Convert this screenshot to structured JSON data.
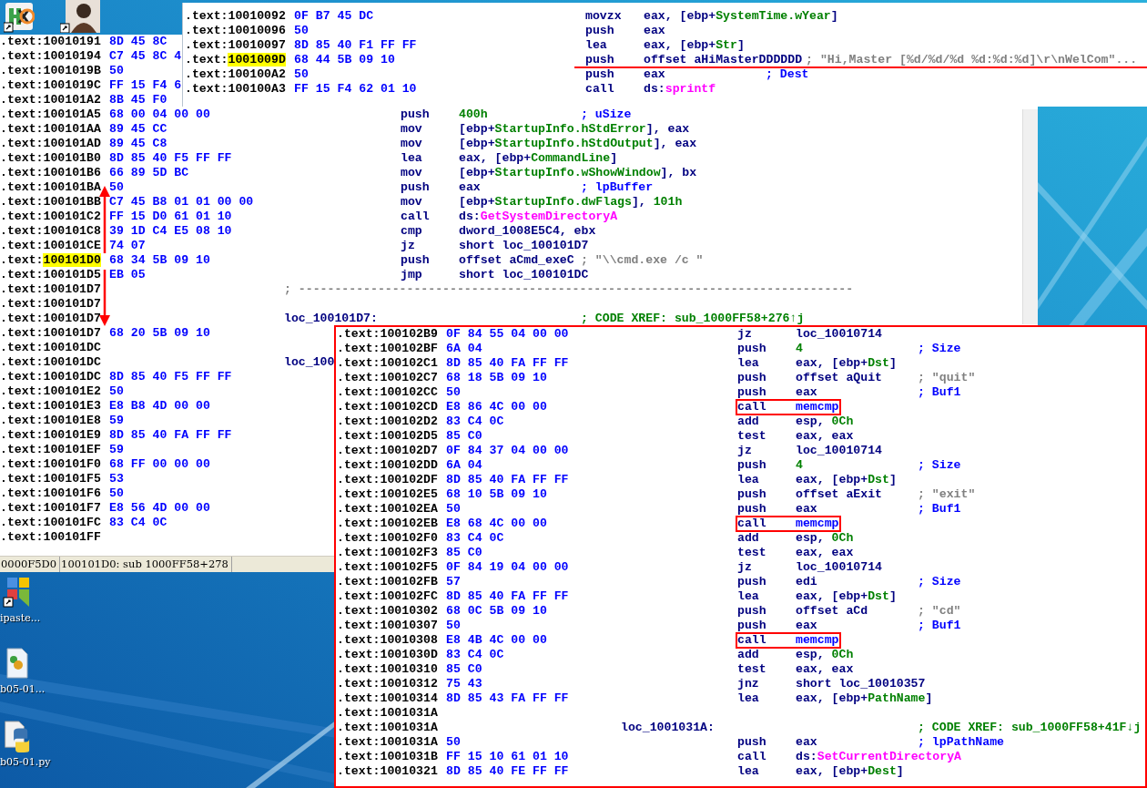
{
  "desktop_icons": [
    {
      "kind": "hex"
    },
    {
      "kind": "portrait"
    },
    {
      "kind": "tiles",
      "label": "ipaste..."
    },
    {
      "kind": "script",
      "label": "b05-01..."
    },
    {
      "kind": "python",
      "label": "b05-01.py"
    }
  ],
  "windows": [
    {
      "kind": "main",
      "status_bar": [
        "0000F5D0",
        "100101D0: sub 1000FF58+278"
      ],
      "rows": [
        {
          "segment": ".text:",
          "address": "10010191",
          "bytes": "8D 45 8C",
          "highlighted": false
        },
        {
          "segment": ".text:",
          "address": "10010194",
          "bytes": "C7 45 8C 4",
          "highlighted": false
        },
        {
          "segment": ".text:",
          "address": "1001019B",
          "bytes": "50",
          "highlighted": false
        },
        {
          "segment": ".text:",
          "address": "1001019C",
          "bytes": "FF 15 F4 6",
          "highlighted": false
        },
        {
          "segment": ".text:",
          "address": "100101A2",
          "bytes": "8B 45 F0",
          "highlighted": false
        },
        {
          "segment": ".text:",
          "address": "100101A5",
          "bytes": "68 00 04 00 00",
          "highlighted": false,
          "mnemonic": "push",
          "operand": [
            {
              "text": "400h",
              "kind": "name"
            }
          ],
          "comment": {
            "text": "; uSize",
            "kind": "auto"
          }
        },
        {
          "segment": ".text:",
          "address": "100101AA",
          "bytes": "89 45 CC",
          "highlighted": false,
          "mnemonic": "mov",
          "operand": [
            {
              "text": "[ebp+",
              "kind": "plain"
            },
            {
              "text": "StartupInfo.hStdError",
              "kind": "name"
            },
            {
              "text": "], eax",
              "kind": "plain"
            }
          ]
        },
        {
          "segment": ".text:",
          "address": "100101AD",
          "bytes": "89 45 C8",
          "highlighted": false,
          "mnemonic": "mov",
          "operand": [
            {
              "text": "[ebp+",
              "kind": "plain"
            },
            {
              "text": "StartupInfo.hStdOutput",
              "kind": "name"
            },
            {
              "text": "], eax",
              "kind": "plain"
            }
          ]
        },
        {
          "segment": ".text:",
          "address": "100101B0",
          "bytes": "8D 85 40 F5 FF FF",
          "highlighted": false,
          "mnemonic": "lea",
          "operand": [
            {
              "text": "eax, [ebp+",
              "kind": "plain"
            },
            {
              "text": "CommandLine",
              "kind": "name"
            },
            {
              "text": "]",
              "kind": "plain"
            }
          ]
        },
        {
          "segment": ".text:",
          "address": "100101B6",
          "bytes": "66 89 5D BC",
          "highlighted": false,
          "mnemonic": "mov",
          "operand": [
            {
              "text": "[ebp+",
              "kind": "plain"
            },
            {
              "text": "StartupInfo.wShowWindow",
              "kind": "name"
            },
            {
              "text": "], bx",
              "kind": "plain"
            }
          ]
        },
        {
          "segment": ".text:",
          "address": "100101BA",
          "bytes": "50",
          "highlighted": false,
          "mnemonic": "push",
          "operand": [
            {
              "text": "eax",
              "kind": "plain"
            }
          ],
          "comment": {
            "text": "; lpBuffer",
            "kind": "auto"
          }
        },
        {
          "segment": ".text:",
          "address": "100101BB",
          "bytes": "C7 45 B8 01 01 00 00",
          "highlighted": false,
          "mnemonic": "mov",
          "operand": [
            {
              "text": "[ebp+",
              "kind": "plain"
            },
            {
              "text": "StartupInfo.dwFlags",
              "kind": "name"
            },
            {
              "text": "], ",
              "kind": "plain"
            },
            {
              "text": "101h",
              "kind": "name"
            }
          ]
        },
        {
          "segment": ".text:",
          "address": "100101C2",
          "bytes": "FF 15 D0 61 01 10",
          "highlighted": false,
          "mnemonic": "call",
          "operand": [
            {
              "text": "ds:",
              "kind": "plain"
            },
            {
              "text": "GetSystemDirectoryA",
              "kind": "api"
            }
          ]
        },
        {
          "segment": ".text:",
          "address": "100101C8",
          "bytes": "39 1D C4 E5 08 10",
          "highlighted": false,
          "mnemonic": "cmp",
          "operand": [
            {
              "text": "dword_1008E5C4, ebx",
              "kind": "plain"
            }
          ]
        },
        {
          "segment": ".text:",
          "address": "100101CE",
          "bytes": "74 07",
          "highlighted": false,
          "mnemonic": "jz",
          "operand": [
            {
              "text": "short loc_100101D7",
              "kind": "plain"
            }
          ]
        },
        {
          "segment": ".text:",
          "address": "100101D0",
          "bytes": "68 34 5B 09 10",
          "highlighted": true,
          "mnemonic": "push",
          "operand": [
            {
              "text": "offset aCmd_exeC",
              "kind": "plain"
            }
          ],
          "comment": {
            "text": "; \"\\\\cmd.exe /c \"",
            "kind": "string"
          }
        },
        {
          "segment": ".text:",
          "address": "100101D5",
          "bytes": "EB 05",
          "highlighted": false,
          "mnemonic": "jmp",
          "operand": [
            {
              "text": "short loc_100101DC",
              "kind": "plain"
            }
          ]
        },
        {
          "segment": ".text:",
          "address": "100101D7",
          "highlighted": false,
          "label": {
            "text": "; -----------------------------------------------------------------------------",
            "kind": "rule"
          }
        },
        {
          "segment": ".text:",
          "address": "100101D7",
          "highlighted": false
        },
        {
          "segment": ".text:",
          "address": "100101D7",
          "highlighted": false,
          "label": {
            "text": "loc_100101D7:",
            "kind": "loc"
          },
          "comment": {
            "text": "; CODE XREF: sub_1000FF58+276↑j",
            "kind": "xref"
          }
        },
        {
          "segment": ".text:",
          "address": "100101D7",
          "bytes": "68 20 5B 09 10",
          "highlighted": false
        },
        {
          "segment": ".text:",
          "address": "100101DC",
          "highlighted": false
        },
        {
          "segment": ".text:",
          "address": "100101DC",
          "highlighted": false,
          "label": {
            "text": "loc_100",
            "kind": "loc"
          }
        },
        {
          "segment": ".text:",
          "address": "100101DC",
          "bytes": "8D 85 40 F5 FF FF",
          "highlighted": false
        },
        {
          "segment": ".text:",
          "address": "100101E2",
          "bytes": "50",
          "highlighted": false
        },
        {
          "segment": ".text:",
          "address": "100101E3",
          "bytes": "E8 B8 4D 00 00",
          "highlighted": false
        },
        {
          "segment": ".text:",
          "address": "100101E8",
          "bytes": "59",
          "highlighted": false
        },
        {
          "segment": ".text:",
          "address": "100101E9",
          "bytes": "8D 85 40 FA FF FF",
          "highlighted": false
        },
        {
          "segment": ".text:",
          "address": "100101EF",
          "bytes": "59",
          "highlighted": false
        },
        {
          "segment": ".text:",
          "address": "100101F0",
          "bytes": "68 FF 00 00 00",
          "highlighted": false
        },
        {
          "segment": ".text:",
          "address": "100101F5",
          "bytes": "53",
          "highlighted": false
        },
        {
          "segment": ".text:",
          "address": "100101F6",
          "bytes": "50",
          "highlighted": false
        },
        {
          "segment": ".text:",
          "address": "100101F7",
          "bytes": "E8 56 4D 00 00",
          "highlighted": false
        },
        {
          "segment": ".text:",
          "address": "100101FC",
          "bytes": "83 C4 0C",
          "highlighted": false
        },
        {
          "segment": ".text:",
          "address": "100101FF",
          "highlighted": false
        }
      ]
    },
    {
      "kind": "top",
      "rows": [
        {
          "segment": ".text:",
          "address": "10010092",
          "bytes": "0F B7 45 DC",
          "highlighted": false,
          "underlined": false,
          "mnemonic": "movzx",
          "operand": [
            {
              "text": "eax, [ebp+",
              "kind": "plain"
            },
            {
              "text": "SystemTime.wYear",
              "kind": "name"
            },
            {
              "text": "]",
              "kind": "plain"
            }
          ]
        },
        {
          "segment": ".text:",
          "address": "10010096",
          "bytes": "50",
          "highlighted": false,
          "underlined": false,
          "mnemonic": "push",
          "operand": [
            {
              "text": "eax",
              "kind": "plain"
            }
          ]
        },
        {
          "segment": ".text:",
          "address": "10010097",
          "bytes": "8D 85 40 F1 FF FF",
          "highlighted": false,
          "underlined": false,
          "mnemonic": "lea",
          "operand": [
            {
              "text": "eax, [ebp+",
              "kind": "plain"
            },
            {
              "text": "Str",
              "kind": "name"
            },
            {
              "text": "]",
              "kind": "plain"
            }
          ]
        },
        {
          "segment": ".text:",
          "address": "1001009D",
          "bytes": "68 44 5B 09 10",
          "highlighted": true,
          "underlined": true,
          "mnemonic": "push",
          "operand": [
            {
              "text": "offset aHiMasterDDDDDD",
              "kind": "plain"
            }
          ],
          "comment": {
            "text": "; \"Hi,Master [%d/%d/%d %d:%d:%d]\\r\\nWelCom\"...",
            "kind": "string"
          }
        },
        {
          "segment": ".text:",
          "address": "100100A2",
          "bytes": "50",
          "highlighted": false,
          "underlined": false,
          "mnemonic": "push",
          "operand": [
            {
              "text": "eax",
              "kind": "plain"
            }
          ],
          "comment": {
            "text": "; Dest",
            "kind": "auto"
          }
        },
        {
          "segment": ".text:",
          "address": "100100A3",
          "bytes": "FF 15 F4 62 01 10",
          "highlighted": false,
          "underlined": false,
          "mnemonic": "call",
          "operand": [
            {
              "text": "ds:",
              "kind": "plain"
            },
            {
              "text": "sprintf",
              "kind": "api"
            }
          ]
        }
      ]
    },
    {
      "kind": "bottom",
      "rows": [
        {
          "segment": ".text:",
          "address": "100102B9",
          "bytes": "0F 84 55 04 00 00",
          "highlighted": false,
          "boxed": false,
          "mnemonic": "jz",
          "operand": [
            {
              "text": "loc_10010714",
              "kind": "plain"
            }
          ]
        },
        {
          "segment": ".text:",
          "address": "100102BF",
          "bytes": "6A 04",
          "highlighted": false,
          "boxed": false,
          "mnemonic": "push",
          "operand": [
            {
              "text": "4",
              "kind": "name"
            }
          ],
          "comment": {
            "text": "; Size",
            "kind": "auto"
          }
        },
        {
          "segment": ".text:",
          "address": "100102C1",
          "bytes": "8D 85 40 FA FF FF",
          "highlighted": false,
          "boxed": false,
          "mnemonic": "lea",
          "operand": [
            {
              "text": "eax, [ebp+",
              "kind": "plain"
            },
            {
              "text": "Dst",
              "kind": "name"
            },
            {
              "text": "]",
              "kind": "plain"
            }
          ]
        },
        {
          "segment": ".text:",
          "address": "100102C7",
          "bytes": "68 18 5B 09 10",
          "highlighted": false,
          "boxed": false,
          "mnemonic": "push",
          "operand": [
            {
              "text": "offset aQuit",
              "kind": "plain"
            }
          ],
          "comment": {
            "text": "; \"quit\"",
            "kind": "string"
          }
        },
        {
          "segment": ".text:",
          "address": "100102CC",
          "bytes": "50",
          "highlighted": false,
          "boxed": false,
          "mnemonic": "push",
          "operand": [
            {
              "text": "eax",
              "kind": "plain"
            }
          ],
          "comment": {
            "text": "; Buf1",
            "kind": "auto"
          }
        },
        {
          "segment": ".text:",
          "address": "100102CD",
          "bytes": "E8 86 4C 00 00",
          "highlighted": false,
          "boxed": true,
          "mnemonic": "call",
          "operand": [
            {
              "text": "memcmp",
              "kind": "import"
            }
          ]
        },
        {
          "segment": ".text:",
          "address": "100102D2",
          "bytes": "83 C4 0C",
          "highlighted": false,
          "boxed": false,
          "mnemonic": "add",
          "operand": [
            {
              "text": "esp, ",
              "kind": "plain"
            },
            {
              "text": "0Ch",
              "kind": "name"
            }
          ]
        },
        {
          "segment": ".text:",
          "address": "100102D5",
          "bytes": "85 C0",
          "highlighted": false,
          "boxed": false,
          "mnemonic": "test",
          "operand": [
            {
              "text": "eax, eax",
              "kind": "plain"
            }
          ]
        },
        {
          "segment": ".text:",
          "address": "100102D7",
          "bytes": "0F 84 37 04 00 00",
          "highlighted": false,
          "boxed": false,
          "mnemonic": "jz",
          "operand": [
            {
              "text": "loc_10010714",
              "kind": "plain"
            }
          ]
        },
        {
          "segment": ".text:",
          "address": "100102DD",
          "bytes": "6A 04",
          "highlighted": false,
          "boxed": false,
          "mnemonic": "push",
          "operand": [
            {
              "text": "4",
              "kind": "name"
            }
          ],
          "comment": {
            "text": "; Size",
            "kind": "auto"
          }
        },
        {
          "segment": ".text:",
          "address": "100102DF",
          "bytes": "8D 85 40 FA FF FF",
          "highlighted": false,
          "boxed": false,
          "mnemonic": "lea",
          "operand": [
            {
              "text": "eax, [ebp+",
              "kind": "plain"
            },
            {
              "text": "Dst",
              "kind": "name"
            },
            {
              "text": "]",
              "kind": "plain"
            }
          ]
        },
        {
          "segment": ".text:",
          "address": "100102E5",
          "bytes": "68 10 5B 09 10",
          "highlighted": false,
          "boxed": false,
          "mnemonic": "push",
          "operand": [
            {
              "text": "offset aExit",
              "kind": "plain"
            }
          ],
          "comment": {
            "text": "; \"exit\"",
            "kind": "string"
          }
        },
        {
          "segment": ".text:",
          "address": "100102EA",
          "bytes": "50",
          "highlighted": false,
          "boxed": false,
          "mnemonic": "push",
          "operand": [
            {
              "text": "eax",
              "kind": "plain"
            }
          ],
          "comment": {
            "text": "; Buf1",
            "kind": "auto"
          }
        },
        {
          "segment": ".text:",
          "address": "100102EB",
          "bytes": "E8 68 4C 00 00",
          "highlighted": false,
          "boxed": true,
          "mnemonic": "call",
          "operand": [
            {
              "text": "memcmp",
              "kind": "import"
            }
          ]
        },
        {
          "segment": ".text:",
          "address": "100102F0",
          "bytes": "83 C4 0C",
          "highlighted": false,
          "boxed": false,
          "mnemonic": "add",
          "operand": [
            {
              "text": "esp, ",
              "kind": "plain"
            },
            {
              "text": "0Ch",
              "kind": "name"
            }
          ]
        },
        {
          "segment": ".text:",
          "address": "100102F3",
          "bytes": "85 C0",
          "highlighted": false,
          "boxed": false,
          "mnemonic": "test",
          "operand": [
            {
              "text": "eax, eax",
              "kind": "plain"
            }
          ]
        },
        {
          "segment": ".text:",
          "address": "100102F5",
          "bytes": "0F 84 19 04 00 00",
          "highlighted": false,
          "boxed": false,
          "mnemonic": "jz",
          "operand": [
            {
              "text": "loc_10010714",
              "kind": "plain"
            }
          ]
        },
        {
          "segment": ".text:",
          "address": "100102FB",
          "bytes": "57",
          "highlighted": false,
          "boxed": false,
          "mnemonic": "push",
          "operand": [
            {
              "text": "edi",
              "kind": "plain"
            }
          ],
          "comment": {
            "text": "; Size",
            "kind": "auto"
          }
        },
        {
          "segment": ".text:",
          "address": "100102FC",
          "bytes": "8D 85 40 FA FF FF",
          "highlighted": false,
          "boxed": false,
          "mnemonic": "lea",
          "operand": [
            {
              "text": "eax, [ebp+",
              "kind": "plain"
            },
            {
              "text": "Dst",
              "kind": "name"
            },
            {
              "text": "]",
              "kind": "plain"
            }
          ]
        },
        {
          "segment": ".text:",
          "address": "10010302",
          "bytes": "68 0C 5B 09 10",
          "highlighted": false,
          "boxed": false,
          "mnemonic": "push",
          "operand": [
            {
              "text": "offset aCd",
              "kind": "plain"
            }
          ],
          "comment": {
            "text": "; \"cd\"",
            "kind": "string"
          }
        },
        {
          "segment": ".text:",
          "address": "10010307",
          "bytes": "50",
          "highlighted": false,
          "boxed": false,
          "mnemonic": "push",
          "operand": [
            {
              "text": "eax",
              "kind": "plain"
            }
          ],
          "comment": {
            "text": "; Buf1",
            "kind": "auto"
          }
        },
        {
          "segment": ".text:",
          "address": "10010308",
          "bytes": "E8 4B 4C 00 00",
          "highlighted": false,
          "boxed": true,
          "mnemonic": "call",
          "operand": [
            {
              "text": "memcmp",
              "kind": "import"
            }
          ]
        },
        {
          "segment": ".text:",
          "address": "1001030D",
          "bytes": "83 C4 0C",
          "highlighted": false,
          "boxed": false,
          "mnemonic": "add",
          "operand": [
            {
              "text": "esp, ",
              "kind": "plain"
            },
            {
              "text": "0Ch",
              "kind": "name"
            }
          ]
        },
        {
          "segment": ".text:",
          "address": "10010310",
          "bytes": "85 C0",
          "highlighted": false,
          "boxed": false,
          "mnemonic": "test",
          "operand": [
            {
              "text": "eax, eax",
              "kind": "plain"
            }
          ]
        },
        {
          "segment": ".text:",
          "address": "10010312",
          "bytes": "75 43",
          "highlighted": false,
          "boxed": false,
          "mnemonic": "jnz",
          "operand": [
            {
              "text": "short loc_10010357",
              "kind": "plain"
            }
          ]
        },
        {
          "segment": ".text:",
          "address": "10010314",
          "bytes": "8D 85 43 FA FF FF",
          "highlighted": false,
          "boxed": false,
          "mnemonic": "lea",
          "operand": [
            {
              "text": "eax, [ebp+",
              "kind": "plain"
            },
            {
              "text": "PathName",
              "kind": "name"
            },
            {
              "text": "]",
              "kind": "plain"
            }
          ]
        },
        {
          "segment": ".text:",
          "address": "1001031A",
          "highlighted": false,
          "boxed": false
        },
        {
          "segment": ".text:",
          "address": "1001031A",
          "highlighted": false,
          "boxed": false,
          "label": {
            "text": "loc_1001031A:",
            "kind": "loc"
          },
          "comment": {
            "text": "; CODE XREF: sub_1000FF58+41F↓j",
            "kind": "xref"
          }
        },
        {
          "segment": ".text:",
          "address": "1001031A",
          "bytes": "50",
          "highlighted": false,
          "boxed": false,
          "mnemonic": "push",
          "operand": [
            {
              "text": "eax",
              "kind": "plain"
            }
          ],
          "comment": {
            "text": "; lpPathName",
            "kind": "auto"
          }
        },
        {
          "segment": ".text:",
          "address": "1001031B",
          "bytes": "FF 15 10 61 01 10",
          "highlighted": false,
          "boxed": false,
          "mnemonic": "call",
          "operand": [
            {
              "text": "ds:",
              "kind": "plain"
            },
            {
              "text": "SetCurrentDirectoryA",
              "kind": "api"
            }
          ]
        },
        {
          "segment": ".text:",
          "address": "10010321",
          "bytes": "8D 85 40 FE FF FF",
          "highlighted": false,
          "boxed": false,
          "mnemonic": "lea",
          "operand": [
            {
              "text": "eax, [ebp+",
              "kind": "plain"
            },
            {
              "text": "Dest",
              "kind": "name"
            },
            {
              "text": "]",
              "kind": "plain"
            }
          ]
        }
      ]
    }
  ]
}
